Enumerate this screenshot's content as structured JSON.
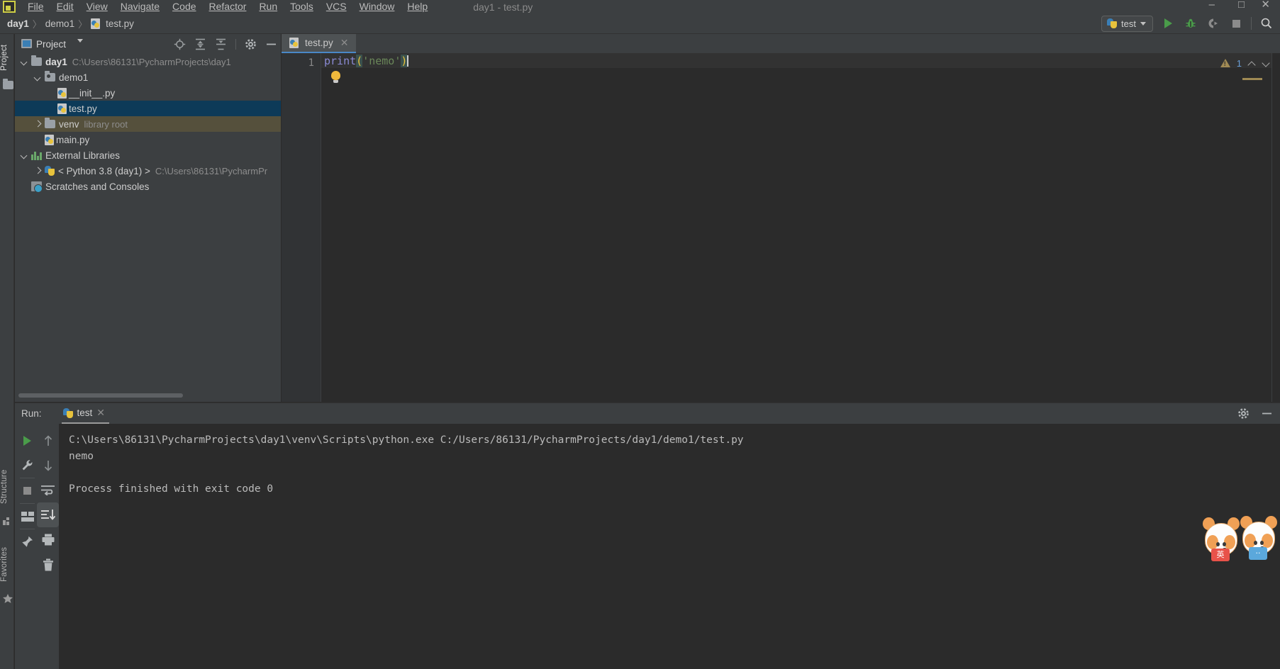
{
  "window": {
    "title": "day1 - test.py",
    "minimize": "–",
    "maximize": "□",
    "close": "✕"
  },
  "menu": {
    "items": [
      {
        "label": "File",
        "mnemonic": "F"
      },
      {
        "label": "Edit",
        "mnemonic": "E"
      },
      {
        "label": "View",
        "mnemonic": "V"
      },
      {
        "label": "Navigate",
        "mnemonic": "N"
      },
      {
        "label": "Code",
        "mnemonic": "C"
      },
      {
        "label": "Refactor",
        "mnemonic": "R"
      },
      {
        "label": "Run",
        "mnemonic": "R"
      },
      {
        "label": "Tools",
        "mnemonic": "T"
      },
      {
        "label": "VCS",
        "mnemonic": "V"
      },
      {
        "label": "Window",
        "mnemonic": "W"
      },
      {
        "label": "Help",
        "mnemonic": "H"
      }
    ]
  },
  "breadcrumb": {
    "root": "day1",
    "sep": "〉",
    "folder": "demo1",
    "file": "test.py"
  },
  "toolbar": {
    "run_config": "test",
    "run_button": "run-icon",
    "debug_button": "bug-icon",
    "coverage_button": "coverage-icon",
    "stop_button": "stop-icon",
    "search_button": "search-icon"
  },
  "left_strip": {
    "project_label": "Project",
    "structure_label": "Structure",
    "favorites_label": "Favorites"
  },
  "project_panel": {
    "title": "Project",
    "actions": [
      "locate-icon",
      "expand-all-icon",
      "collapse-all-icon",
      "gear-icon",
      "hide-icon"
    ],
    "tree": [
      {
        "depth": 0,
        "arrow": "down",
        "icon": "folder",
        "name": "day1",
        "hint": "C:\\Users\\86131\\PycharmProjects\\day1",
        "bold": true,
        "state": "normal"
      },
      {
        "depth": 1,
        "arrow": "down",
        "icon": "package",
        "name": "demo1",
        "hint": "",
        "bold": false,
        "state": "normal"
      },
      {
        "depth": 2,
        "arrow": "none",
        "icon": "pyfile",
        "name": "__init__.py",
        "hint": "",
        "bold": false,
        "state": "normal"
      },
      {
        "depth": 2,
        "arrow": "none",
        "icon": "pyfile",
        "name": "test.py",
        "hint": "",
        "bold": false,
        "state": "selected"
      },
      {
        "depth": 1,
        "arrow": "right",
        "icon": "folder",
        "name": "venv",
        "hint": "library root",
        "bold": false,
        "state": "highlighted"
      },
      {
        "depth": 1,
        "arrow": "none",
        "icon": "pyfile",
        "name": "main.py",
        "hint": "",
        "bold": false,
        "state": "normal"
      },
      {
        "depth": 0,
        "arrow": "down",
        "icon": "libraries",
        "name": "External Libraries",
        "hint": "",
        "bold": false,
        "state": "normal"
      },
      {
        "depth": 1,
        "arrow": "right",
        "icon": "python",
        "name": "< Python 3.8 (day1) >",
        "hint": "C:\\Users\\86131\\PycharmPr",
        "bold": false,
        "state": "normal"
      },
      {
        "depth": 0,
        "arrow": "none",
        "icon": "scratch",
        "name": "Scratches and Consoles",
        "hint": "",
        "bold": false,
        "state": "normal"
      }
    ]
  },
  "editor": {
    "tab_label": "test.py",
    "tab_close": "✕",
    "line_number": "1",
    "code": {
      "fn": "print",
      "open_paren": "(",
      "string": "'nemo'",
      "close_paren": ")"
    },
    "intention_bulb": "lightbulb-icon",
    "inspection": {
      "warning_count": "1",
      "prev": "chevron-up-icon",
      "next": "chevron-down-icon"
    }
  },
  "run_panel": {
    "label": "Run:",
    "tab_name": "test",
    "tab_close": "✕",
    "header_actions": [
      "gear-icon",
      "hide-icon"
    ],
    "left_actions": [
      "rerun-icon",
      "wrench-icon",
      "stop-icon",
      "layout-icon",
      "pin-icon"
    ],
    "right_actions": [
      "up-arrow-icon",
      "down-arrow-icon",
      "soft-wrap-icon",
      "scroll-to-end-icon",
      "print-icon",
      "trash-icon"
    ],
    "console": {
      "command": "C:\\Users\\86131\\PycharmProjects\\day1\\venv\\Scripts\\python.exe C:/Users/86131/PycharmProjects/day1/demo1/test.py",
      "output": "nemo",
      "exit_line": "Process finished with exit code 0"
    }
  },
  "mascots": [
    {
      "badge": "英"
    },
    {
      "badge": "··"
    }
  ],
  "colors": {
    "panel_bg": "#3c3f41",
    "editor_bg": "#2b2b2b",
    "selection": "#0d3a58",
    "highlight": "#55503c",
    "accent": "#4a88c7",
    "run_green": "#4a9c4a",
    "string_green": "#6a8759",
    "keyword_blue": "#8a8ad4",
    "warning": "#a08a54"
  }
}
